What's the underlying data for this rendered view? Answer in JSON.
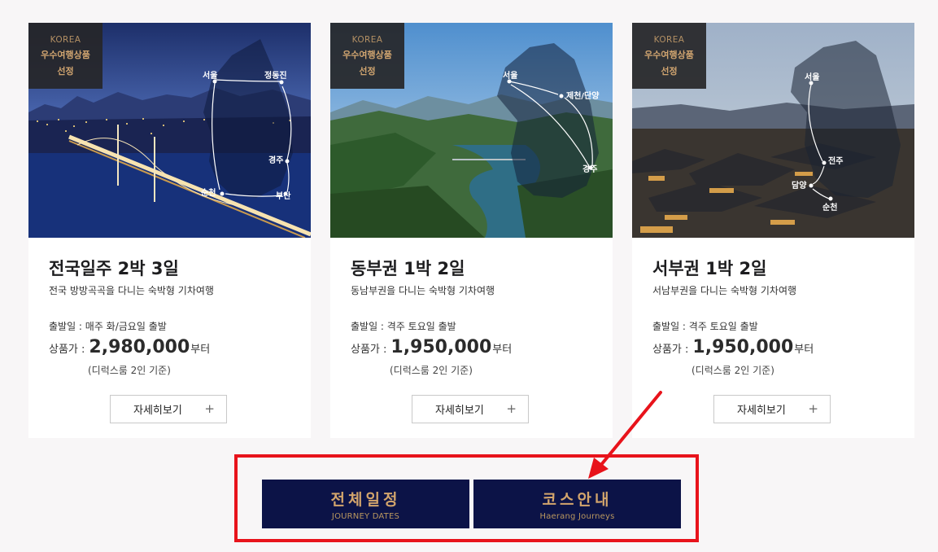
{
  "badge": {
    "line1": "KOREA",
    "line2": "우수여행상품",
    "line3": "선정"
  },
  "cards": [
    {
      "title": "전국일주 2박 3일",
      "desc": "전국 방방곡곡을 다니는 숙박형 기차여행",
      "departure": "출발일 : 매주 화/금요일 출발",
      "price_label": "상품가 :",
      "price": "2,980,000",
      "price_suffix": "부터",
      "price_note": "(디럭스룸 2인 기준)",
      "detail_label": "자세히보기",
      "map_labels": [
        "서울",
        "정동진",
        "경주",
        "부산",
        "순천"
      ]
    },
    {
      "title": "동부권 1박 2일",
      "desc": "동남부권을 다니는 숙박형 기차여행",
      "departure": "출발일 : 격주 토요일 출발",
      "price_label": "상품가 :",
      "price": "1,950,000",
      "price_suffix": "부터",
      "price_note": "(디럭스룸 2인 기준)",
      "detail_label": "자세히보기",
      "map_labels": [
        "서울",
        "제천/단양",
        "경주"
      ]
    },
    {
      "title": "서부권 1박 2일",
      "desc": "서남부권을 다니는 숙박형 기차여행",
      "departure": "출발일 : 격주 토요일 출발",
      "price_label": "상품가 :",
      "price": "1,950,000",
      "price_suffix": "부터",
      "price_note": "(디럭스룸 2인 기준)",
      "detail_label": "자세히보기",
      "map_labels": [
        "서울",
        "전주",
        "담양",
        "순천"
      ]
    }
  ],
  "plus_glyph": "+",
  "nav": {
    "all_schedule": {
      "ko": "전체일정",
      "en": "JOURNEY DATES"
    },
    "course_guide": {
      "ko": "코스안내",
      "en": "Haerang Journeys"
    }
  },
  "colors": {
    "nav_bg": "#0c1347",
    "nav_text": "#d3a56c",
    "highlight": "#e8131b"
  }
}
